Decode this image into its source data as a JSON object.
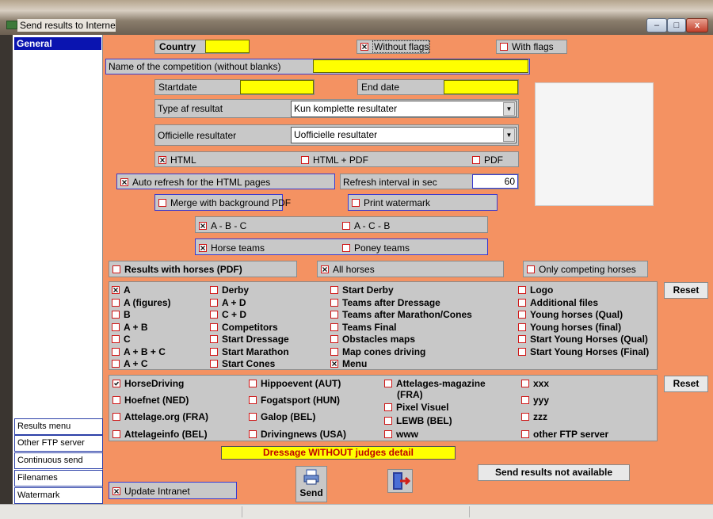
{
  "window": {
    "title": "Send results to Internet",
    "min": "–",
    "max": "□",
    "close": "x"
  },
  "sidebar": {
    "selected": "General",
    "items": [
      "Results menu",
      "Other FTP server",
      "Continuous send",
      "Filenames",
      "Watermark"
    ]
  },
  "form": {
    "country_label": "Country",
    "country_value": "",
    "without_flags": "Without flags",
    "with_flags": "With flags",
    "competition_name_label": "Name of the competition (without blanks)",
    "competition_name_value": "",
    "startdate_label": "Startdate",
    "enddate_label": "End date",
    "type_label": "Type af resultat",
    "type_value": "Kun komplette resultater",
    "official_label": "Officielle resultater",
    "official_value": "Uofficielle resultater",
    "html": "HTML",
    "html_pdf": "HTML + PDF",
    "pdf": "PDF",
    "auto_refresh": "Auto refresh for the HTML pages",
    "refresh_interval_label": "Refresh interval in sec",
    "refresh_interval_value": "60",
    "merge_bg": "Merge with background PDF",
    "print_watermark": "Print watermark",
    "abc": "A - B - C",
    "acb": "A - C - B",
    "horse_teams": "Horse teams",
    "poney_teams": "Poney teams",
    "results_with_horses": "Results with horses (PDF)",
    "all_horses": "All horses",
    "only_competing": "Only competing horses"
  },
  "results": {
    "col1": [
      {
        "t": "A",
        "on": true
      },
      {
        "t": "A (figures)",
        "on": false
      },
      {
        "t": "B",
        "on": false
      },
      {
        "t": "A + B",
        "on": false
      },
      {
        "t": "C",
        "on": false
      },
      {
        "t": "A + B + C",
        "on": false
      },
      {
        "t": "A + C",
        "on": false
      }
    ],
    "col2": [
      {
        "t": "Derby",
        "on": false
      },
      {
        "t": "A + D",
        "on": false
      },
      {
        "t": "C + D",
        "on": false
      },
      {
        "t": "Competitors",
        "on": false
      },
      {
        "t": "Start Dressage",
        "on": false
      },
      {
        "t": "Start Marathon",
        "on": false
      },
      {
        "t": "Start Cones",
        "on": false
      }
    ],
    "col3": [
      {
        "t": "Start Derby",
        "on": false
      },
      {
        "t": "Teams after Dressage",
        "on": false
      },
      {
        "t": "Teams after Marathon/Cones",
        "on": false
      },
      {
        "t": "Teams Final",
        "on": false
      },
      {
        "t": "Obstacles maps",
        "on": false
      },
      {
        "t": "Map cones driving",
        "on": false
      },
      {
        "t": "Menu",
        "on": true
      }
    ],
    "col4": [
      {
        "t": "Logo",
        "on": false
      },
      {
        "t": "Additional files",
        "on": false
      },
      {
        "t": "Young horses (Qual)",
        "on": false
      },
      {
        "t": "Young horses (final)",
        "on": false
      },
      {
        "t": "Start Young Horses (Qual)",
        "on": false
      },
      {
        "t": "Start Young Horses (Final)",
        "on": false
      }
    ],
    "reset": "Reset"
  },
  "sites": {
    "reset": "Reset",
    "horsedriving": "HorseDriving",
    "hoefnet": "Hoefnet (NED)",
    "attelage_org": "Attelage.org (FRA)",
    "attelageinfo": "Attelageinfo (BEL)",
    "hippoevent": "Hippoevent (AUT)",
    "fogatsport": "Fogatsport (HUN)",
    "galop": "Galop (BEL)",
    "drivingnews": "Drivingnews (USA)",
    "attelages_mag_1": "Attelages-magazine",
    "attelages_mag_2": "(FRA)",
    "pixel": "Pixel Visuel",
    "lewb": "LEWB (BEL)",
    "www": "www",
    "xxx": "xxx",
    "yyy": "yyy",
    "zzz": "zzz",
    "other_ftp": "other FTP server"
  },
  "footer": {
    "dressage_notice": "Dressage WITHOUT judges detail",
    "update_intranet": "Update Intranet",
    "send": "Send",
    "not_available": "Send results not available"
  }
}
